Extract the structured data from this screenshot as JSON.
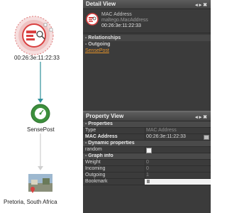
{
  "graph": {
    "nodes": [
      {
        "label": "00:26:3e:11:22:33",
        "icon": "mac-address-icon"
      },
      {
        "label": "SensePost",
        "icon": "speedometer-icon"
      },
      {
        "label": "Pretoria, South Africa",
        "icon": "location-icon"
      }
    ]
  },
  "detail_view": {
    "title": "Detail View",
    "entity_type": "MAC Address",
    "entity_class": "maltego.MacAddress",
    "entity_value": "00:26:3e:11:22:33",
    "relationships_label": "Relationships",
    "outgoing_label": "Outgoing",
    "outgoing_link": "SensePost"
  },
  "property_view": {
    "title": "Property View",
    "properties_label": "Properties",
    "type_key": "Type",
    "type_value": "MAC Address",
    "mac_key": "MAC Address",
    "mac_value": "00:26:3e:11:22:33",
    "dynamic_label": "Dynamic properties",
    "random_key": "random",
    "graph_info_label": "Graph info",
    "weight_key": "Weight",
    "weight_value": "0",
    "incoming_key": "Incoming",
    "incoming_value": "0",
    "outgoing_key": "Outgoing",
    "outgoing_value": "1",
    "bookmark_key": "Bookmark"
  },
  "colors": {
    "accent_red": "#d94040",
    "edge_teal": "#2f8f9a",
    "node_green": "#3c8f3c",
    "link_orange": "#e8952b"
  }
}
